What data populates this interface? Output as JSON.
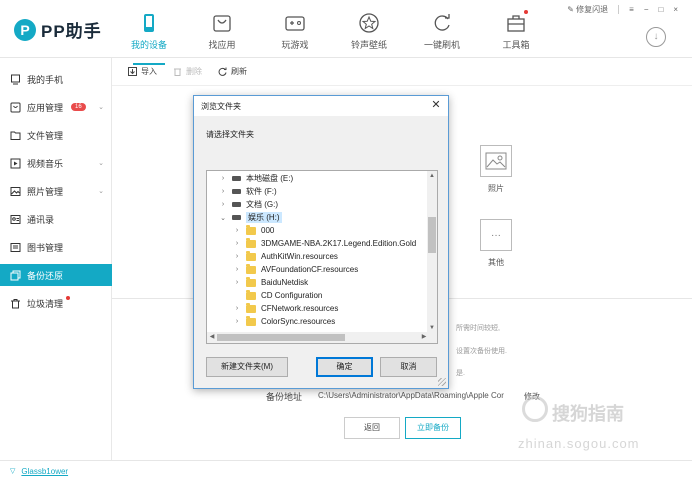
{
  "app": {
    "logo_mark": "P",
    "title": "PP助手"
  },
  "nav": [
    {
      "label": "我的设备",
      "icon": "phone-icon",
      "active": true
    },
    {
      "label": "找应用",
      "icon": "app-store-icon",
      "active": false
    },
    {
      "label": "玩游戏",
      "icon": "gamepad-icon",
      "active": false
    },
    {
      "label": "铃声壁纸",
      "icon": "music-star-icon",
      "active": false
    },
    {
      "label": "一键刷机",
      "icon": "refresh-icon",
      "active": false
    },
    {
      "label": "工具箱",
      "icon": "toolbox-icon",
      "active": false
    }
  ],
  "window": {
    "repair_label": "修复闪退",
    "menu_glyph": "≡",
    "min_glyph": "−",
    "max_glyph": "□",
    "close_glyph": "×",
    "download_glyph": "↓"
  },
  "sidebar": {
    "items": [
      {
        "label": "我的手机",
        "icon": "phone-outline-icon"
      },
      {
        "label": "应用管理",
        "icon": "app-manage-icon",
        "badge": "16",
        "chevron": "⌄"
      },
      {
        "label": "文件管理",
        "icon": "folder-icon"
      },
      {
        "label": "视频音乐",
        "icon": "video-icon",
        "chevron": "⌄"
      },
      {
        "label": "照片管理",
        "icon": "photo-icon",
        "chevron": "⌄"
      },
      {
        "label": "通讯录",
        "icon": "contacts-icon"
      },
      {
        "label": "图书管理",
        "icon": "book-icon"
      },
      {
        "label": "备份还原",
        "icon": "backup-icon",
        "active": true
      },
      {
        "label": "垃圾清理",
        "icon": "trash-icon",
        "dot": true
      }
    ]
  },
  "toolbar": {
    "import_label": "导入",
    "delete_label": "删除",
    "refresh_label": "刷新"
  },
  "categories": [
    {
      "label": "照片",
      "icon": "photo-frame-icon"
    },
    {
      "label": "其他",
      "icon": "more-dots-icon",
      "glyph": "···"
    }
  ],
  "hints": [
    "所需时间较短,",
    "设置次备份使用.",
    "是."
  ],
  "backup": {
    "address_label": "备份地址",
    "address_value": "C:\\Users\\Administrator\\AppData\\Roaming\\Apple Cor",
    "modify_label": "修改",
    "back_button": "返回",
    "backup_button": "立即备份"
  },
  "watermark": {
    "brand": "搜狗指南",
    "url": "zhinan.sogou.com"
  },
  "statusbar": {
    "device_name": "Glassb1ower"
  },
  "dialog": {
    "title": "浏览文件夹",
    "close_glyph": "✕",
    "prompt": "请选择文件夹",
    "tree": [
      {
        "label": "本地磁盘 (E:)",
        "kind": "drive",
        "expander": "›",
        "level": 0
      },
      {
        "label": "软件 (F:)",
        "kind": "drive",
        "expander": "›",
        "level": 0
      },
      {
        "label": "文档 (G:)",
        "kind": "drive",
        "expander": "›",
        "level": 0
      },
      {
        "label": "娱乐 (H:)",
        "kind": "drive",
        "expander": "⌄",
        "level": 0,
        "selected": true
      },
      {
        "label": "000",
        "kind": "folder",
        "expander": "›",
        "level": 1
      },
      {
        "label": "3DMGAME-NBA.2K17.Legend.Edition.Gold",
        "kind": "folder",
        "expander": "›",
        "level": 1
      },
      {
        "label": "AuthKitWin.resources",
        "kind": "folder",
        "expander": "›",
        "level": 1
      },
      {
        "label": "AVFoundationCF.resources",
        "kind": "folder",
        "expander": "›",
        "level": 1
      },
      {
        "label": "BaiduNetdisk",
        "kind": "folder",
        "expander": "›",
        "level": 1
      },
      {
        "label": "CD Configuration",
        "kind": "folder",
        "expander": "",
        "level": 1
      },
      {
        "label": "CFNetwork.resources",
        "kind": "folder",
        "expander": "›",
        "level": 1
      },
      {
        "label": "ColorSync.resources",
        "kind": "folder",
        "expander": "›",
        "level": 1
      }
    ],
    "new_folder_button": "新建文件夹(M)",
    "ok_button": "确定",
    "cancel_button": "取消"
  },
  "colors": {
    "accent": "#14a9c5",
    "badge": "#e94b4b",
    "dialog_border": "#5a9bd5"
  }
}
